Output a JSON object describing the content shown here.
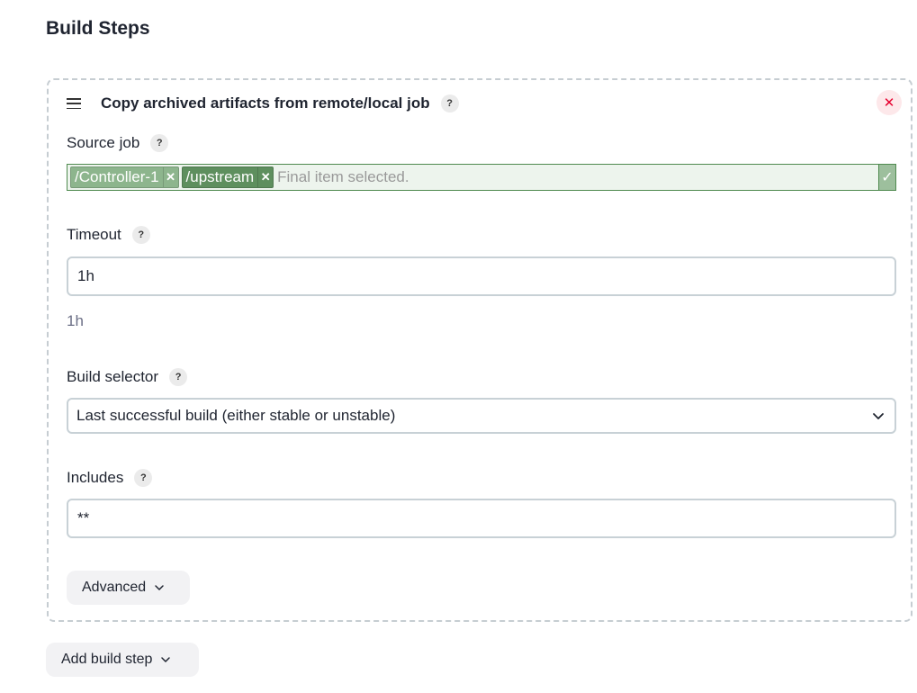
{
  "section": {
    "title": "Build Steps"
  },
  "step": {
    "title": "Copy archived artifacts from remote/local job",
    "help_glyph": "?",
    "close_glyph": "✕",
    "fields": {
      "source_job": {
        "label": "Source job",
        "tags": [
          {
            "label": "/Controller-1",
            "remove": "✕"
          },
          {
            "label": "/upstream",
            "remove": "✕"
          }
        ],
        "placeholder": "Final item selected.",
        "valid_glyph": "✓"
      },
      "timeout": {
        "label": "Timeout",
        "value": "1h",
        "preview": "1h"
      },
      "build_selector": {
        "label": "Build selector",
        "selected": "Last successful build (either stable or unstable)"
      },
      "includes": {
        "label": "Includes",
        "value": "**"
      }
    },
    "advanced_label": "Advanced"
  },
  "add_build_step_label": "Add build step",
  "colors": {
    "accent_green": "#4f8a4f",
    "danger": "#e6002e"
  }
}
